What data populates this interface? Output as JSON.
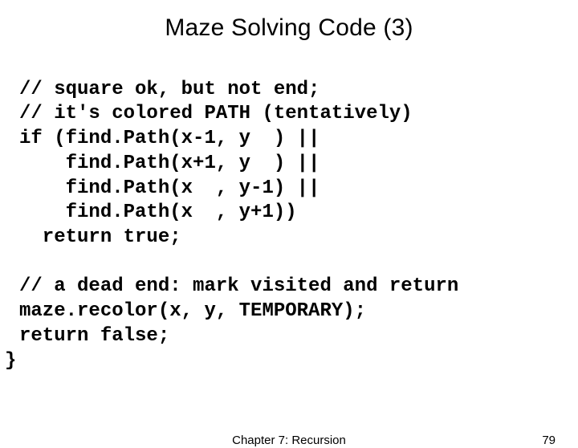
{
  "title": "Maze Solving Code (3)",
  "code": {
    "l1": "// square ok, but not end;",
    "l2": "// it's colored PATH (tentatively)",
    "l3": "if (find.Path(x-1, y  ) ||",
    "l4": "    find.Path(x+1, y  ) ||",
    "l5": "    find.Path(x  , y-1) ||",
    "l6": "    find.Path(x  , y+1))",
    "l7": "  return true;",
    "l8": "",
    "l9": "// a dead end: mark visited and return",
    "l10": "maze.recolor(x, y, TEMPORARY);",
    "l11": "return false;"
  },
  "closing_brace": "}",
  "footer": {
    "chapter": "Chapter 7: Recursion",
    "page": "79"
  }
}
